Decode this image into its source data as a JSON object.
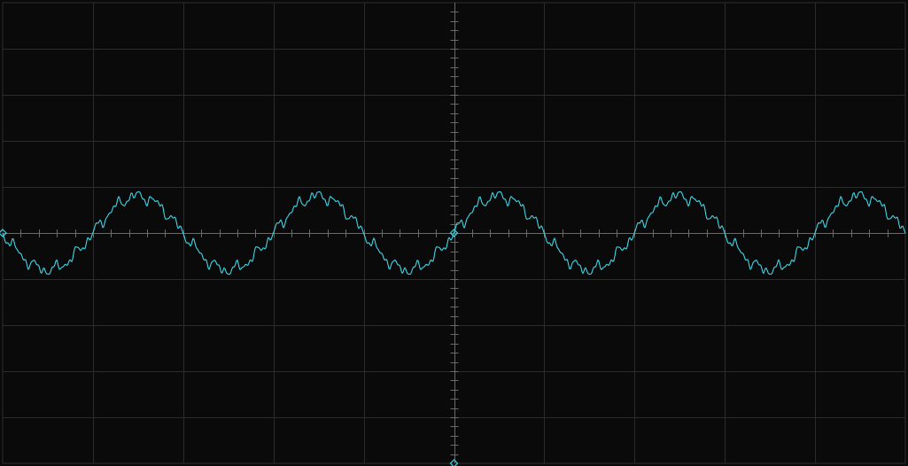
{
  "screen": {
    "colors": {
      "background": "#0a0a0a",
      "border": "#2e2e2e",
      "grid": "#2b2b2b",
      "center_axis": "#6a6a6a",
      "trace": "#3fd6e6",
      "marker": "#3fd6e6"
    },
    "grid": {
      "horizontal_divisions": 10,
      "vertical_divisions": 10,
      "minor_ticks_per_division": 5
    }
  },
  "trace": {
    "name": "",
    "waveform": "noisy-sine",
    "cycles_on_screen": 5,
    "amplitude_divisions": 0.8,
    "noise_divisions": 0.18,
    "phase_start": "negative-going"
  }
}
